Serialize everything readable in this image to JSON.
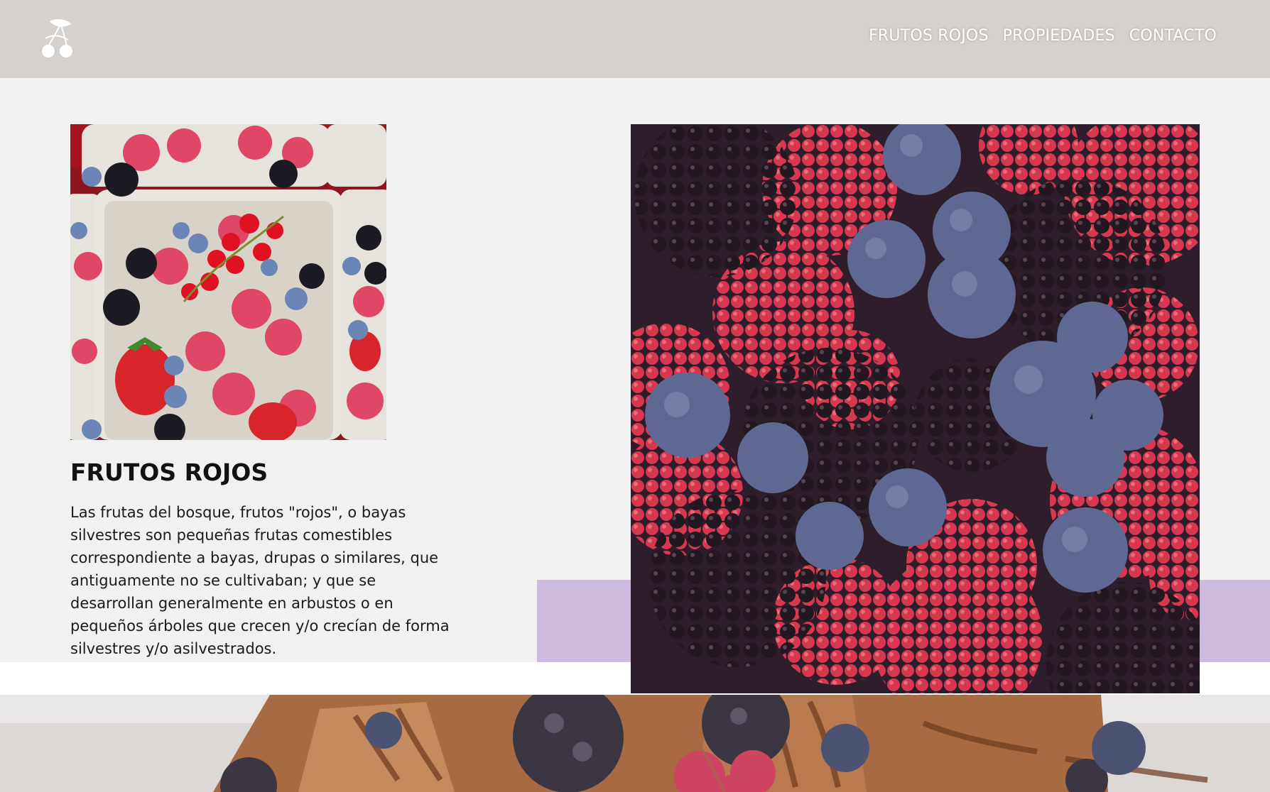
{
  "nav": {
    "items": [
      "FRUTOS ROJOS",
      "PROPIEDADES",
      "CONTACTO"
    ]
  },
  "logo": {
    "icon": "cherry-logo-icon"
  },
  "section": {
    "title": "FRUTOS ROJOS",
    "text": "Las frutas del bosque, frutos \"rojos\", o bayas silvestres son pequeñas frutas comestibles correspondiente a bayas, drupas o similares, que antiguamente no se cultivaban; y que se desarrollan generalmente en arbustos o en pequeños árboles que crecen y/o crecían de forma silvestres y/o asilvestrados."
  },
  "colors": {
    "header_bg": "#d5d1ce",
    "page_bg": "#f2f1f1",
    "accent_purple": "#cdbadf"
  }
}
